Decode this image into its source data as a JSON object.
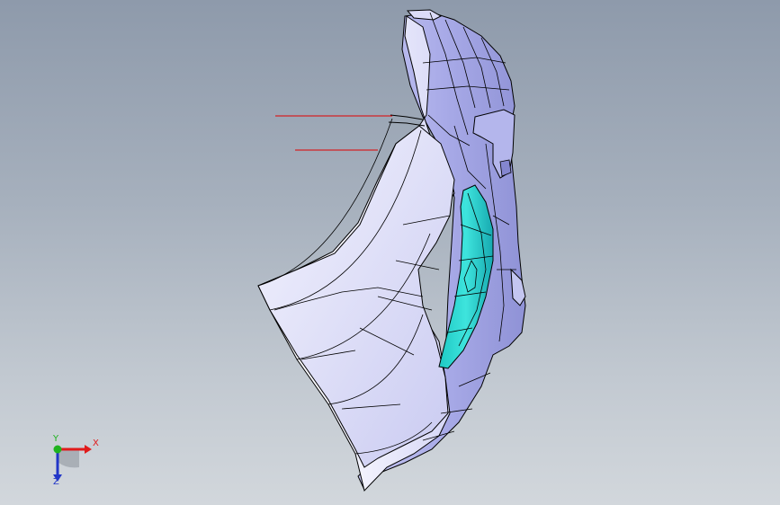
{
  "viewport": {
    "background_top": "#8e9aab",
    "background_bottom": "#d2d7dc"
  },
  "model": {
    "surface_color": "#e9e9fb",
    "shade_color": "#9a9ce0",
    "edge_color": "#000000",
    "highlight_color": "#27d7d2",
    "annotation_line_color": "#e00000"
  },
  "triad": {
    "x_label": "X",
    "y_label": "Y",
    "z_label": "Z",
    "x_color": "#e01b1b",
    "y_color": "#1fb31f",
    "z_color": "#2236c8"
  }
}
